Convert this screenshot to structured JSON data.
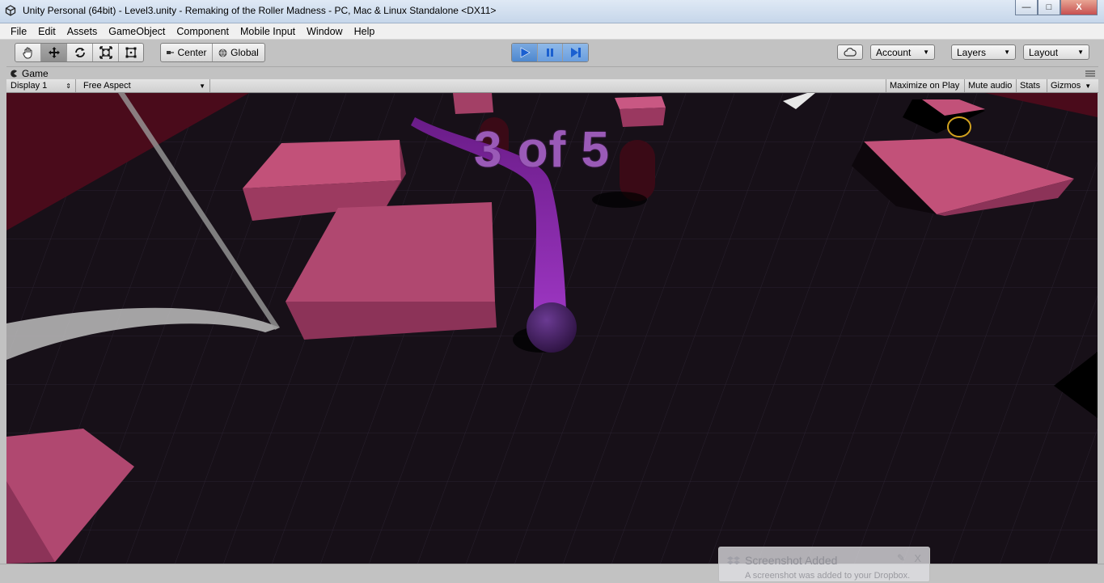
{
  "window": {
    "title": "Unity Personal (64bit) - Level3.unity - Remaking of the Roller Madness - PC, Mac & Linux Standalone <DX11>",
    "minimize_glyph": "—",
    "maximize_glyph": "□",
    "close_glyph": "X"
  },
  "menu": [
    "File",
    "Edit",
    "Assets",
    "GameObject",
    "Component",
    "Mobile Input",
    "Window",
    "Help"
  ],
  "toolbar": {
    "transform_tools": [
      "hand-icon",
      "move-icon",
      "rotate-icon",
      "scale-icon",
      "rect-icon"
    ],
    "pivot_label": "Center",
    "space_label": "Global",
    "play_state": "playing",
    "account_label": "Account",
    "layers_label": "Layers",
    "layout_label": "Layout"
  },
  "game_view": {
    "tab_label": "Game",
    "display_label": "Display 1",
    "aspect_label": "Free Aspect",
    "maximize_label": "Maximize on Play",
    "mute_label": "Mute audio",
    "stats_label": "Stats",
    "gizmos_label": "Gizmos"
  },
  "hud": {
    "counter_text": "3 of 5"
  },
  "notification": {
    "title": "Screenshot Added",
    "body": "A screenshot was added to your Dropbox.",
    "close_glyph": "X"
  },
  "colors": {
    "play_blue": "#4e88cf",
    "block_pink": "#b04870",
    "trail_purple": "#8a2aa8",
    "counter_purple": "#9a5ab7",
    "ground": "#171018"
  }
}
